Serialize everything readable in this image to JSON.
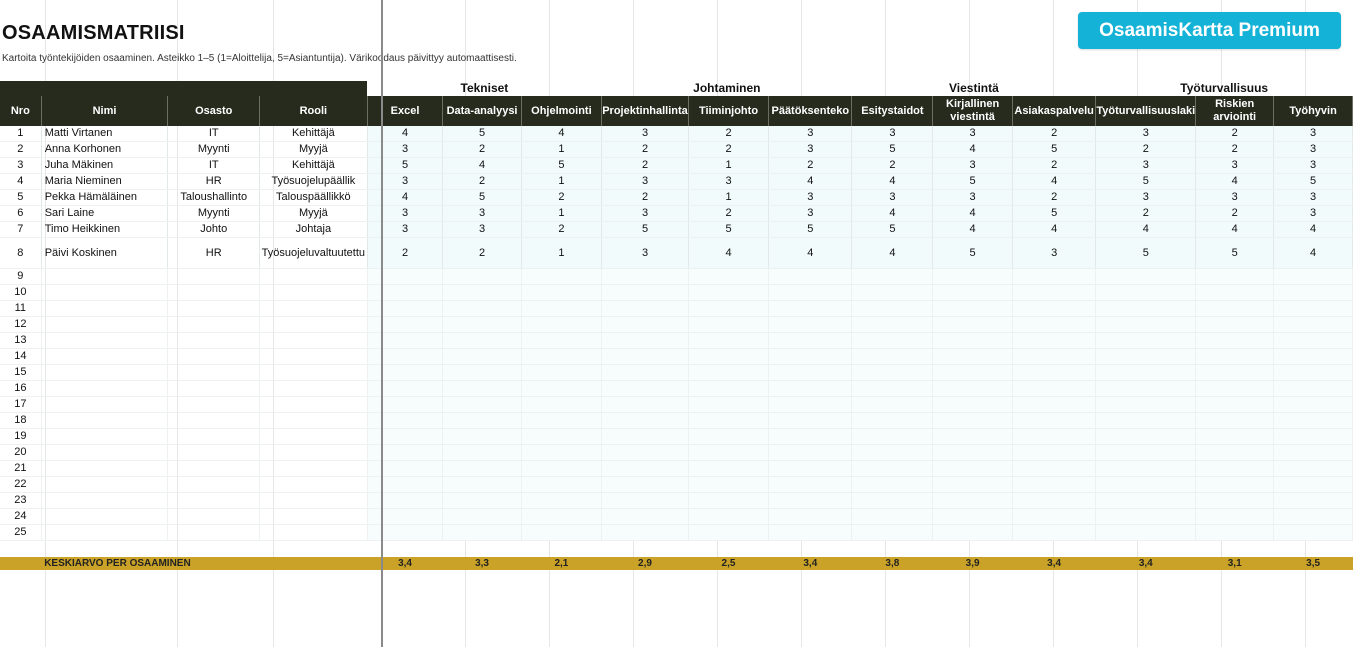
{
  "title": "OSAAMISMATRIISI",
  "subtitle": "Kartoita työntekijöiden osaaminen. Asteikko 1–5 (1=Aloittelija, 5=Asiantuntija). Värikoodaus päivittyy automaattisesti.",
  "premium_button": "OsaamisKartta Premium",
  "groups": {
    "tekniset": "Tekniset",
    "johtaminen": "Johtaminen",
    "viestinta": "Viestintä",
    "tyoturvallisuus": "Työturvallisuus"
  },
  "headers": [
    "Nro",
    "Nimi",
    "Osasto",
    "Rooli",
    "Excel",
    "Data-analyysi",
    "Ohjelmointi",
    "Projektinhallinta",
    "Tiiminjohto",
    "Päätöksenteko",
    "Esitystaidot",
    "Kirjallinen viestintä",
    "Asiakaspalvelu",
    "Työturvallisuuslaki",
    "Riskien arviointi",
    "Työhyvin"
  ],
  "rows": [
    {
      "nro": "1",
      "name": "Matti Virtanen",
      "dept": "IT",
      "role": "Kehittäjä",
      "s": [
        "4",
        "5",
        "4",
        "3",
        "2",
        "3",
        "3",
        "3",
        "2",
        "3",
        "2",
        "3"
      ]
    },
    {
      "nro": "2",
      "name": "Anna Korhonen",
      "dept": "Myynti",
      "role": "Myyjä",
      "s": [
        "3",
        "2",
        "1",
        "2",
        "2",
        "3",
        "5",
        "4",
        "5",
        "2",
        "2",
        "3"
      ]
    },
    {
      "nro": "3",
      "name": "Juha Mäkinen",
      "dept": "IT",
      "role": "Kehittäjä",
      "s": [
        "5",
        "4",
        "5",
        "2",
        "1",
        "2",
        "2",
        "3",
        "2",
        "3",
        "3",
        "3"
      ]
    },
    {
      "nro": "4",
      "name": "Maria Nieminen",
      "dept": "HR",
      "role": "Työsuojelupäällik",
      "s": [
        "3",
        "2",
        "1",
        "3",
        "3",
        "4",
        "4",
        "5",
        "4",
        "5",
        "4",
        "5"
      ]
    },
    {
      "nro": "5",
      "name": "Pekka Hämäläinen",
      "dept": "Taloushallinto",
      "role": "Talouspäällikkö",
      "s": [
        "4",
        "5",
        "2",
        "2",
        "1",
        "3",
        "3",
        "3",
        "2",
        "3",
        "3",
        "3"
      ]
    },
    {
      "nro": "6",
      "name": "Sari Laine",
      "dept": "Myynti",
      "role": "Myyjä",
      "s": [
        "3",
        "3",
        "1",
        "3",
        "2",
        "3",
        "4",
        "4",
        "5",
        "2",
        "2",
        "3"
      ]
    },
    {
      "nro": "7",
      "name": "Timo Heikkinen",
      "dept": "Johto",
      "role": "Johtaja",
      "s": [
        "3",
        "3",
        "2",
        "5",
        "5",
        "5",
        "5",
        "4",
        "4",
        "4",
        "4",
        "4"
      ]
    },
    {
      "nro": "8",
      "name": "Päivi Koskinen",
      "dept": "HR",
      "role": "Työsuojeluvaltuutettu",
      "s": [
        "2",
        "2",
        "1",
        "3",
        "4",
        "4",
        "4",
        "5",
        "3",
        "5",
        "5",
        "4"
      ]
    }
  ],
  "empty_rows": [
    "9",
    "10",
    "11",
    "12",
    "13",
    "14",
    "15",
    "16",
    "17",
    "18",
    "19",
    "20",
    "21",
    "22",
    "23",
    "24",
    "25"
  ],
  "average": {
    "label": "KESKIARVO PER OSAAMINEN",
    "values": [
      "3,4",
      "3,3",
      "2,1",
      "2,9",
      "2,5",
      "3,4",
      "3,8",
      "3,9",
      "3,4",
      "3,4",
      "3,1",
      "3,5"
    ]
  },
  "colors": {
    "header_bg": "#272b1e",
    "accent": "#13b2d6",
    "average_bg": "#c9a227"
  }
}
